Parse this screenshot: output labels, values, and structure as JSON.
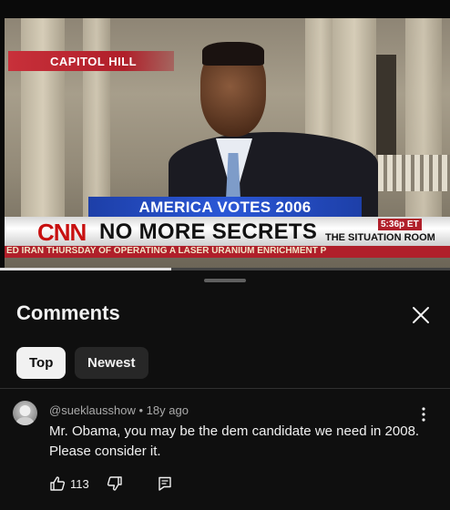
{
  "video": {
    "location_label": "CAPITOL HILL",
    "banner_top": "AMERICA VOTES 2006",
    "network": "CNN",
    "headline": "NO MORE SECRETS",
    "time": "5:36p ET",
    "show": "THE SITUATION ROOM",
    "ticker": "ED IRAN THURSDAY OF OPERATING A LASER URANIUM ENRICHMENT P",
    "progress_fraction": 0.38
  },
  "comments_panel": {
    "title": "Comments",
    "sort_options": [
      "Top",
      "Newest"
    ],
    "selected_sort": "Top"
  },
  "comments": [
    {
      "author": "@sueklausshow",
      "age": "18y ago",
      "text": "Mr. Obama, you may be the dem candidate we need in 2008. Please consider it.",
      "likes": "113"
    }
  ],
  "icons": {
    "close": "close-icon",
    "more": "more-vert-icon",
    "like": "thumb-up-icon",
    "dislike": "thumb-down-icon",
    "reply": "reply-icon"
  },
  "colors": {
    "background": "#0f0f0f",
    "chip_selected_bg": "#f1f1f1",
    "chip_bg": "#272727",
    "text_primary": "#f1f1f1",
    "text_secondary": "#aaaaaa"
  }
}
